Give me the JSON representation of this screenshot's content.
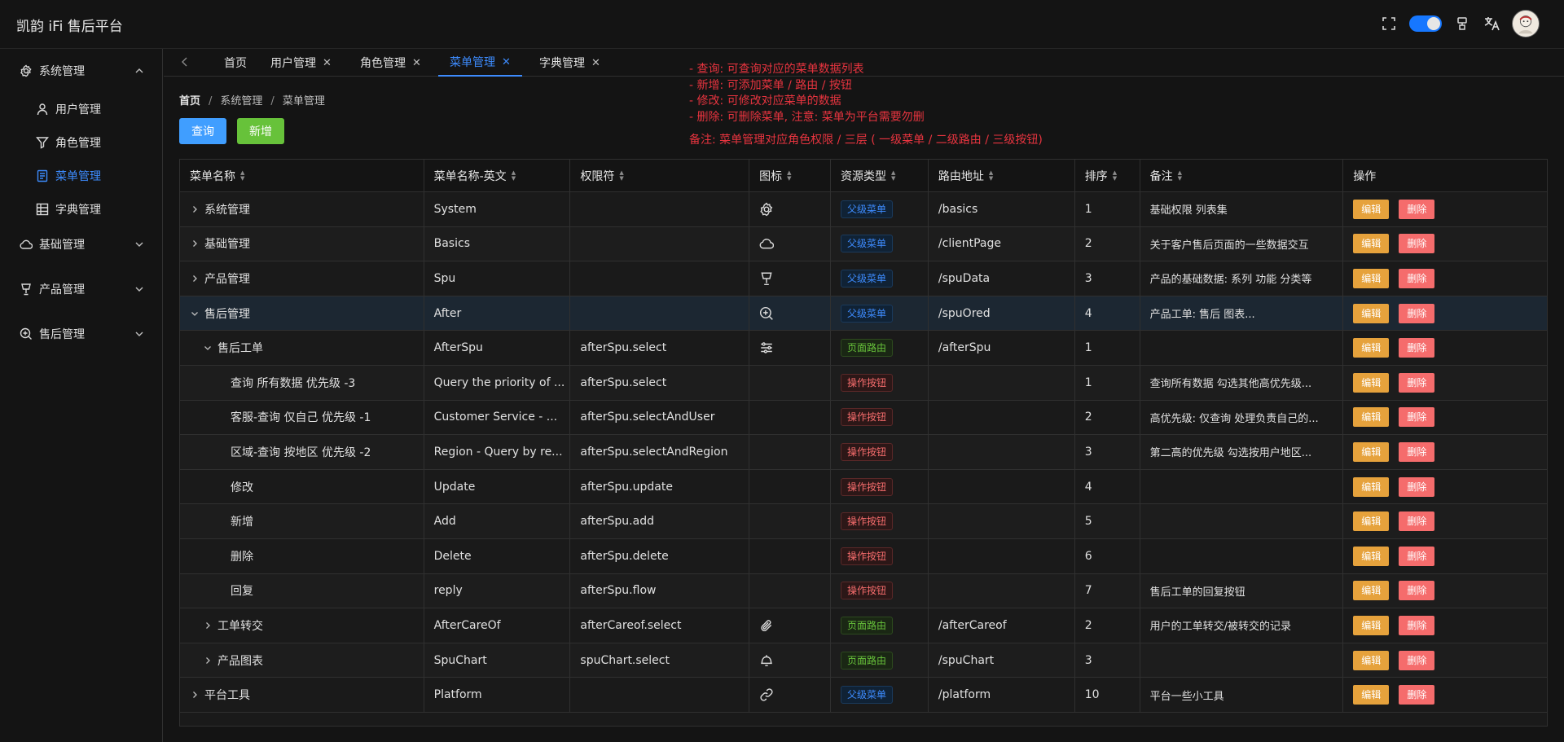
{
  "app": {
    "title": "凯韵 iFi 售后平台"
  },
  "sidebar": {
    "groups": [
      {
        "label": "系统管理",
        "icon": "gear-icon",
        "expanded": true,
        "items": [
          {
            "label": "用户管理",
            "icon": "user-icon"
          },
          {
            "label": "角色管理",
            "icon": "filter-icon"
          },
          {
            "label": "菜单管理",
            "icon": "document-icon",
            "active": true
          },
          {
            "label": "字典管理",
            "icon": "grid-icon"
          }
        ]
      },
      {
        "label": "基础管理",
        "icon": "cloud-icon"
      },
      {
        "label": "产品管理",
        "icon": "lamp-icon"
      },
      {
        "label": "售后管理",
        "icon": "search-plus-icon"
      }
    ]
  },
  "tabs": [
    {
      "label": "首页",
      "closable": false
    },
    {
      "label": "用户管理",
      "closable": true
    },
    {
      "label": "角色管理",
      "closable": true
    },
    {
      "label": "菜单管理",
      "closable": true,
      "active": true
    },
    {
      "label": "字典管理",
      "closable": true
    }
  ],
  "annotation": {
    "lines": [
      "- 查询: 可查询对应的菜单数据列表",
      "- 新增: 可添加菜单 / 路由 / 按钮",
      "- 修改: 可修改对应菜单的数据",
      "- 删除: 可删除菜单, 注意: 菜单为平台需要勿删"
    ],
    "remark": "备注: 菜单管理对应角色权限 / 三层 ( 一级菜单 / 二级路由 / 三级按钮)"
  },
  "breadcrumb": [
    "首页",
    "系统管理",
    "菜单管理"
  ],
  "actions": {
    "query": "查询",
    "add": "新增"
  },
  "table": {
    "headers": [
      "菜单名称",
      "菜单名称-英文",
      "权限符",
      "图标",
      "资源类型",
      "路由地址",
      "排序",
      "备注",
      "操作"
    ],
    "edit_label": "编辑",
    "delete_label": "删除",
    "rows": [
      {
        "level": 0,
        "expand": "collapsed",
        "name": "系统管理",
        "en": "System",
        "perm": "",
        "icon": "gear-icon",
        "type": "父级菜单",
        "typeClass": "blue",
        "route": "/basics",
        "order": "1",
        "remark": "基础权限 列表集"
      },
      {
        "level": 0,
        "expand": "collapsed",
        "name": "基础管理",
        "en": "Basics",
        "perm": "",
        "icon": "cloud-icon",
        "type": "父级菜单",
        "typeClass": "blue",
        "route": "/clientPage",
        "order": "2",
        "remark": "关于客户售后页面的一些数据交互"
      },
      {
        "level": 0,
        "expand": "collapsed",
        "name": "产品管理",
        "en": "Spu",
        "perm": "",
        "icon": "lamp-icon",
        "type": "父级菜单",
        "typeClass": "blue",
        "route": "/spuData",
        "order": "3",
        "remark": "产品的基础数据: 系列 功能 分类等"
      },
      {
        "level": 0,
        "expand": "expanded",
        "name": "售后管理",
        "en": "After",
        "perm": "",
        "icon": "search-plus-icon",
        "type": "父级菜单",
        "typeClass": "blue",
        "route": "/spuOred",
        "order": "4",
        "remark": "产品工单: 售后 图表...",
        "highlight": true
      },
      {
        "level": 1,
        "expand": "expanded",
        "name": "售后工单",
        "en": "AfterSpu",
        "perm": "afterSpu.select",
        "icon": "sliders-icon",
        "type": "页面路由",
        "typeClass": "green",
        "route": "/afterSpu",
        "order": "1",
        "remark": ""
      },
      {
        "level": 2,
        "expand": "none",
        "name": "查询 所有数据 优先级 -3",
        "en": "Query the priority of ...",
        "perm": "afterSpu.select",
        "icon": "",
        "type": "操作按钮",
        "typeClass": "red",
        "route": "",
        "order": "1",
        "remark": "查询所有数据 勾选其他高优先级..."
      },
      {
        "level": 2,
        "expand": "none",
        "name": "客服-查询 仅自己 优先级 -1",
        "en": "Customer Service - ...",
        "perm": "afterSpu.selectAndUser",
        "icon": "",
        "type": "操作按钮",
        "typeClass": "red",
        "route": "",
        "order": "2",
        "remark": "高优先级: 仅查询 处理负责自己的..."
      },
      {
        "level": 2,
        "expand": "none",
        "name": "区域-查询 按地区 优先级 -2",
        "en": "Region - Query by re...",
        "perm": "afterSpu.selectAndRegion",
        "icon": "",
        "type": "操作按钮",
        "typeClass": "red",
        "route": "",
        "order": "3",
        "remark": "第二高的优先级 勾选按用户地区..."
      },
      {
        "level": 2,
        "expand": "none",
        "name": "修改",
        "en": "Update",
        "perm": "afterSpu.update",
        "icon": "",
        "type": "操作按钮",
        "typeClass": "red",
        "route": "",
        "order": "4",
        "remark": ""
      },
      {
        "level": 2,
        "expand": "none",
        "name": "新增",
        "en": "Add",
        "perm": "afterSpu.add",
        "icon": "",
        "type": "操作按钮",
        "typeClass": "red",
        "route": "",
        "order": "5",
        "remark": ""
      },
      {
        "level": 2,
        "expand": "none",
        "name": "删除",
        "en": "Delete",
        "perm": "afterSpu.delete",
        "icon": "",
        "type": "操作按钮",
        "typeClass": "red",
        "route": "",
        "order": "6",
        "remark": ""
      },
      {
        "level": 2,
        "expand": "none",
        "name": "回复",
        "en": "reply",
        "perm": "afterSpu.flow",
        "icon": "",
        "type": "操作按钮",
        "typeClass": "red",
        "route": "",
        "order": "7",
        "remark": "售后工单的回复按钮"
      },
      {
        "level": 1,
        "expand": "collapsed",
        "name": "工单转交",
        "en": "AfterCareOf",
        "perm": "afterCareof.select",
        "icon": "paperclip-icon",
        "type": "页面路由",
        "typeClass": "green",
        "route": "/afterCareof",
        "order": "2",
        "remark": "用户的工单转交/被转交的记录"
      },
      {
        "level": 1,
        "expand": "collapsed",
        "name": "产品图表",
        "en": "SpuChart",
        "perm": "spuChart.select",
        "icon": "bell-icon",
        "type": "页面路由",
        "typeClass": "green",
        "route": "/spuChart",
        "order": "3",
        "remark": ""
      },
      {
        "level": 0,
        "expand": "collapsed",
        "name": "平台工具",
        "en": "Platform",
        "perm": "",
        "icon": "link-icon",
        "type": "父级菜单",
        "typeClass": "blue",
        "route": "/platform",
        "order": "10",
        "remark": "平台一些小工具"
      }
    ]
  }
}
